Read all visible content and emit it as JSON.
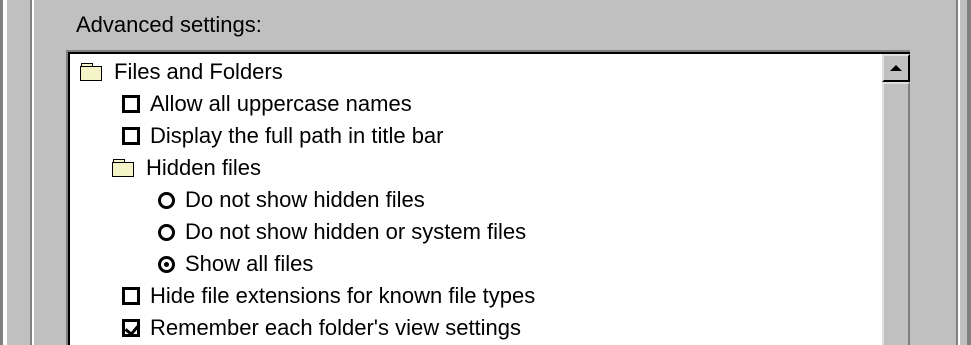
{
  "section": {
    "label": "Advanced settings:"
  },
  "tree": {
    "items": [
      {
        "type": "folder",
        "label": "Files and Folders"
      },
      {
        "type": "checkbox",
        "label": "Allow all uppercase names",
        "checked": false
      },
      {
        "type": "checkbox",
        "label": "Display the full path in title bar",
        "checked": false
      },
      {
        "type": "folder",
        "label": "Hidden files"
      },
      {
        "type": "radio",
        "label": "Do not show hidden files",
        "selected": false
      },
      {
        "type": "radio",
        "label": "Do not show hidden or system files",
        "selected": false
      },
      {
        "type": "radio",
        "label": "Show all files",
        "selected": true
      },
      {
        "type": "checkbox",
        "label": "Hide file extensions for known file types",
        "checked": false
      },
      {
        "type": "checkbox",
        "label": "Remember each folder's view settings",
        "checked": true
      }
    ]
  },
  "icons": {
    "folder": "folder-icon",
    "scroll_up": "scroll-up-arrow-icon"
  },
  "colors": {
    "face": "#c0c0c0",
    "window": "#ffffff",
    "folder": "#f4f4c8"
  }
}
